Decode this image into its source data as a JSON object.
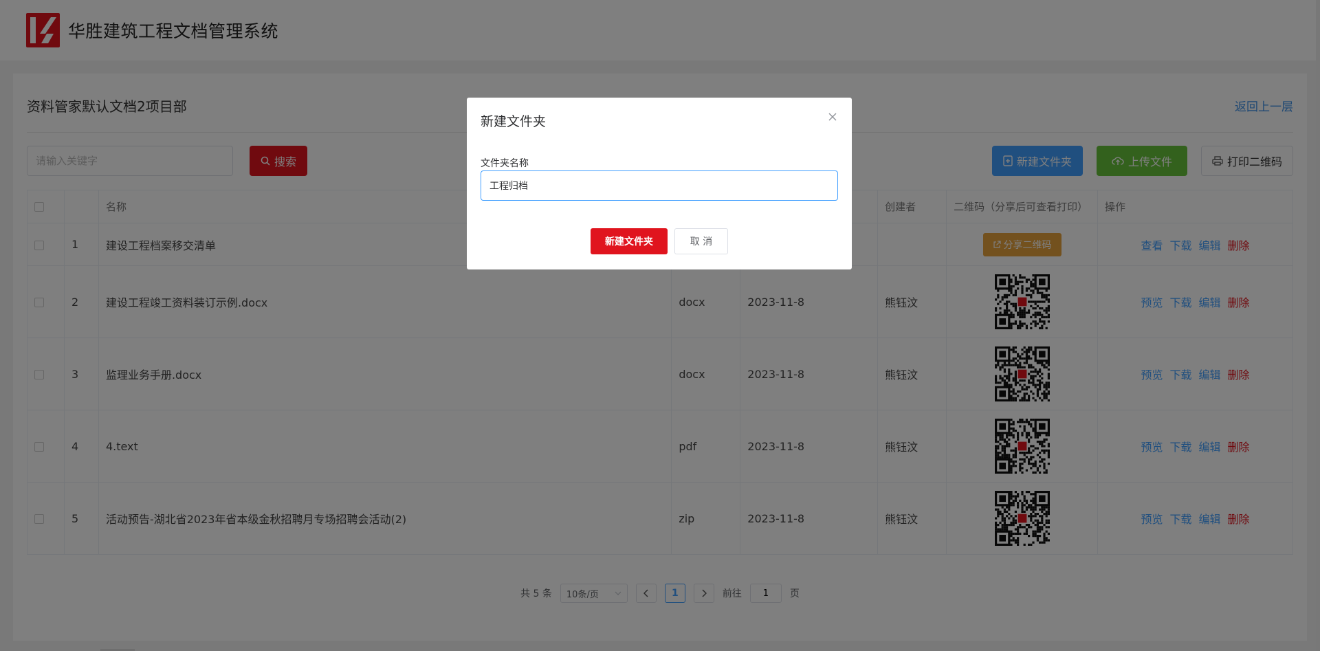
{
  "header": {
    "app_title": "华胜建筑工程文档管理系统"
  },
  "panel": {
    "title": "资料管家默认文档2项目部",
    "back_link": "返回上一层",
    "search_placeholder": "请输入关键字",
    "search_button": "搜索",
    "new_folder_button": "新建文件夹",
    "upload_button": "上传文件",
    "print_qr_button": "打印二维码"
  },
  "table": {
    "headers": [
      "名称",
      "创建者",
      "二维码（分享后可查看打印）",
      "操作"
    ],
    "rows": [
      {
        "index": "1",
        "name": "建设工程档案移交清单",
        "type": "",
        "date": "",
        "creator": "",
        "qr_action": "分享二维码",
        "actions": [
          "查看",
          "下载",
          "编辑",
          "删除"
        ]
      },
      {
        "index": "2",
        "name": "建设工程竣工资料装订示例.docx",
        "type": "docx",
        "date": "2023-11-8",
        "creator": "熊钰汶",
        "actions": [
          "预览",
          "下载",
          "编辑",
          "删除"
        ]
      },
      {
        "index": "3",
        "name": "监理业务手册.docx",
        "type": "docx",
        "date": "2023-11-8",
        "creator": "熊钰汶",
        "actions": [
          "预览",
          "下载",
          "编辑",
          "删除"
        ]
      },
      {
        "index": "4",
        "name": "4.text",
        "type": "pdf",
        "date": "2023-11-8",
        "creator": "熊钰汶",
        "actions": [
          "预览",
          "下载",
          "编辑",
          "删除"
        ]
      },
      {
        "index": "5",
        "name": "活动预告-湖北省2023年省本级金秋招聘月专场招聘会活动(2)",
        "type": "zip",
        "date": "2023-11-8",
        "creator": "熊钰汶",
        "actions": [
          "预览",
          "下载",
          "编辑",
          "删除"
        ]
      }
    ]
  },
  "pagination": {
    "total": "共 5 条",
    "page_size": "10条/页",
    "current_page": "1",
    "goto_label": "前往",
    "goto_value": "1",
    "page_suffix": "页"
  },
  "dialog": {
    "title": "新建文件夹",
    "field_label": "文件夹名称",
    "field_value": "工程归档",
    "confirm_button": "新建文件夹",
    "cancel_button": "取 消"
  },
  "colors": {
    "brand_red": "#e0141e",
    "primary_blue": "#409eff",
    "success_green": "#67c23a",
    "warning_orange": "#e6a23c"
  }
}
